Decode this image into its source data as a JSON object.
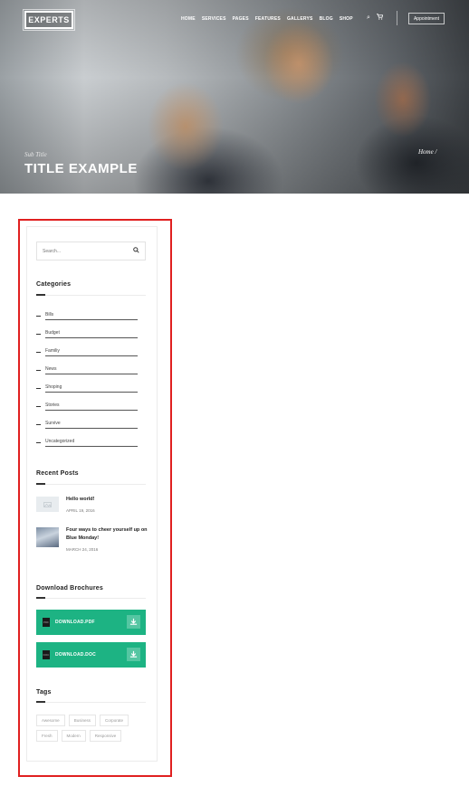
{
  "header": {
    "logo": "EXPERTS",
    "nav": [
      "HOME",
      "SERVICES",
      "PAGES",
      "FEATURES",
      "GALLERYS",
      "BLOG",
      "SHOP"
    ],
    "search_icon": "search-icon",
    "cart_icon": "cart-icon",
    "appointment_label": "Appointment"
  },
  "hero": {
    "subtitle": "Sub Title",
    "title": "TITLE EXAMPLE",
    "breadcrumb": "Home /"
  },
  "sidebar": {
    "search_placeholder": "Search...",
    "categories_title": "Categories",
    "categories": [
      "Bills",
      "Budget",
      "Familiy",
      "News",
      "Shoping",
      "Stories",
      "Survive",
      "Uncategorized"
    ],
    "recent_posts_title": "Recent Posts",
    "recent_posts": [
      {
        "title": "Hello world!",
        "date": "APRIL 19, 2016"
      },
      {
        "title": "Four ways to cheer yourself up on Blue Monday!",
        "date": "MARCH 24, 2016"
      }
    ],
    "downloads_title": "Download Brochures",
    "downloads": [
      {
        "label": "DOWNLOAD.PDF",
        "file_tag": "PDF"
      },
      {
        "label": "DOWNLOAD.DOC",
        "file_tag": "DOC"
      }
    ],
    "tags_title": "Tags",
    "tags": [
      "Awesome",
      "Business",
      "Corporate",
      "Fresh",
      "Modern",
      "Responsive"
    ]
  },
  "colors": {
    "accent": "#1db383",
    "highlight_frame": "#e02020"
  }
}
